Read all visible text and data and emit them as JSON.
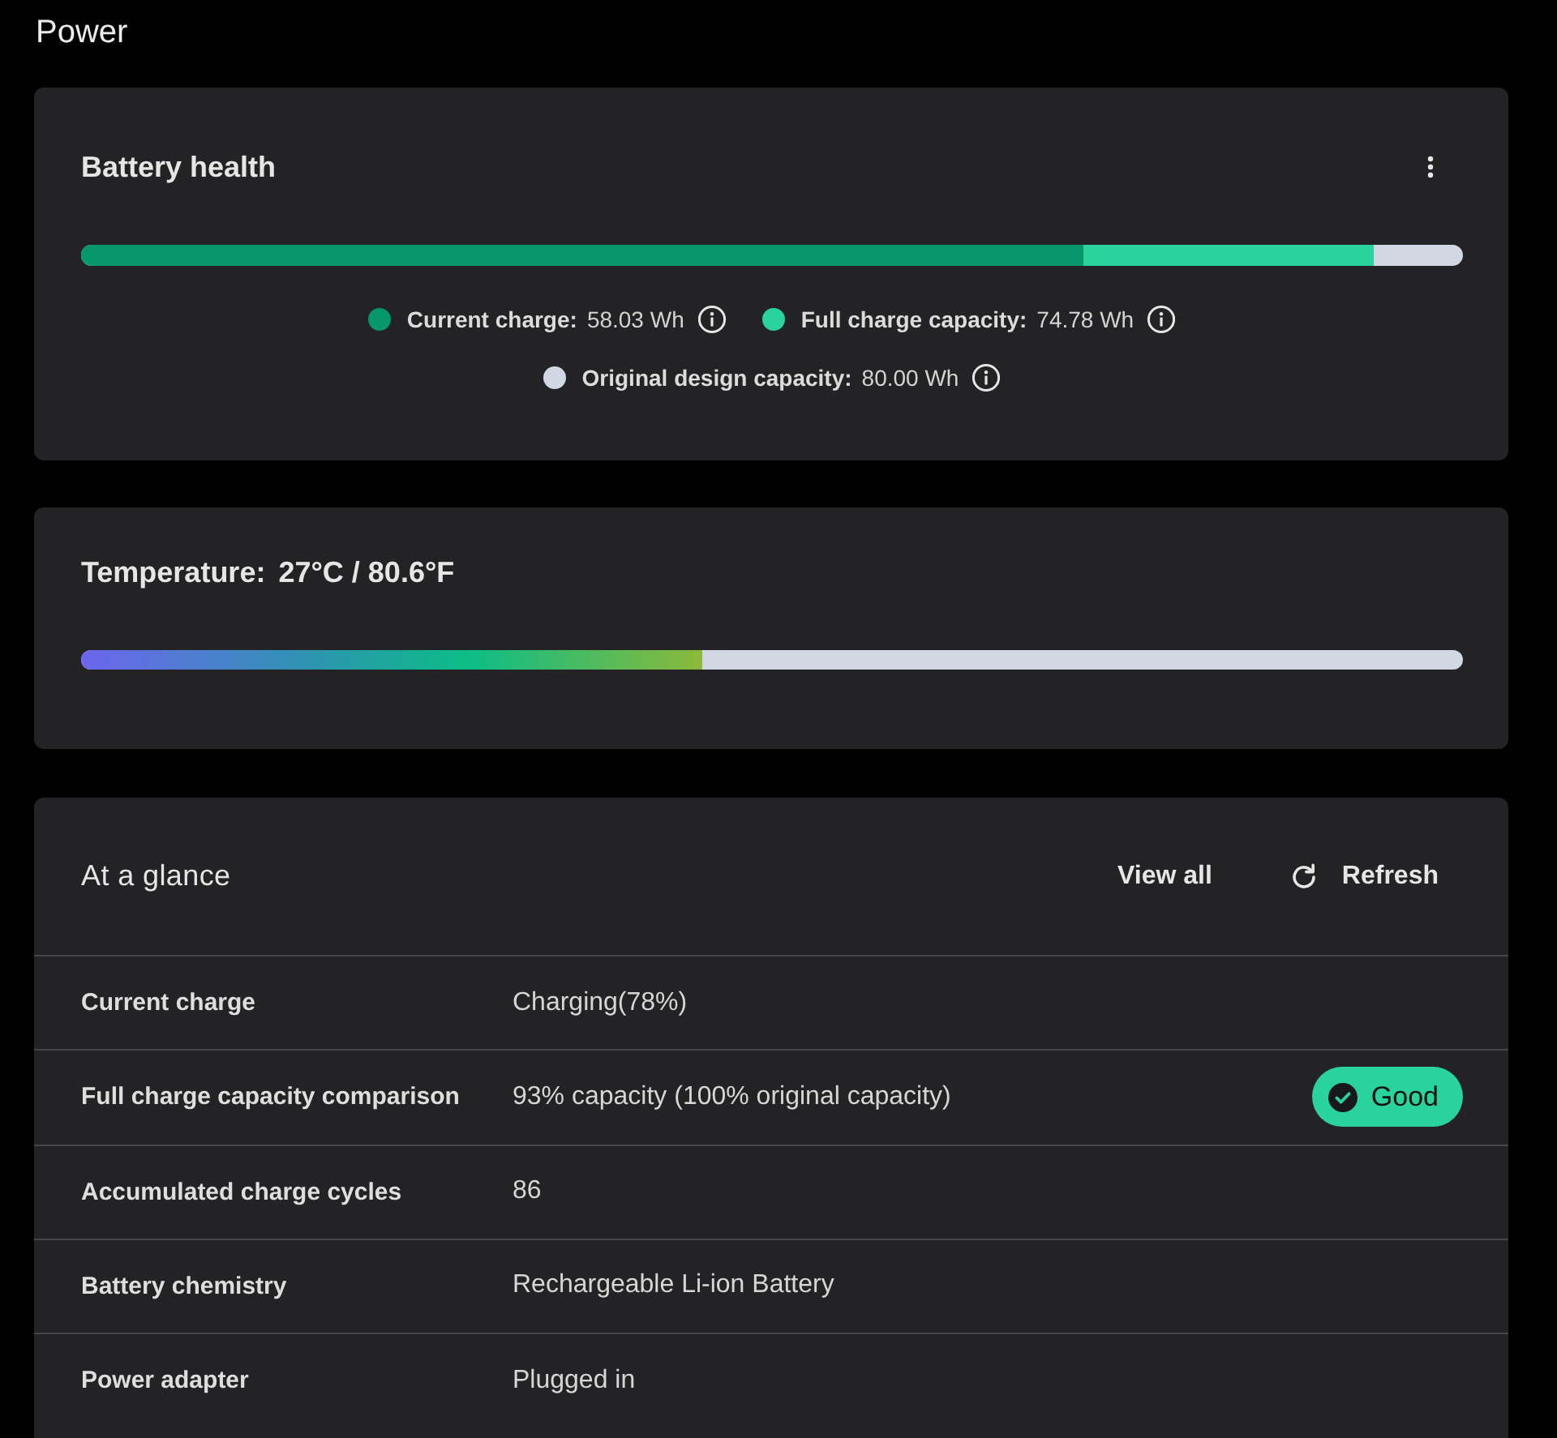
{
  "page_title": "Power",
  "battery_health": {
    "title": "Battery health",
    "legend": [
      {
        "label": "Current charge:",
        "value": "58.03 Wh",
        "color": "#05966b",
        "level": 0.725
      },
      {
        "label": "Full charge capacity:",
        "value": "74.78 Wh",
        "color": "#2bd39c",
        "level": 0.935
      },
      {
        "label": "Original design capacity:",
        "value": "80.00 Wh",
        "color": "#d2d7e4",
        "level": 1
      }
    ]
  },
  "temperature": {
    "label": "Temperature:",
    "value": "27°C / 80.6°F",
    "level": 0.45
  },
  "at_a_glance": {
    "title": "At a glance",
    "actions": [
      {
        "label": "View all",
        "kind": "link"
      },
      {
        "label": "Refresh",
        "kind": "refresh"
      }
    ],
    "rows": [
      {
        "label": "Current charge",
        "value": "Charging(78%)"
      },
      {
        "label": "Full charge capacity comparison",
        "value": "93% capacity (100% original capacity)",
        "badge": {
          "label": "Good"
        }
      },
      {
        "label": "Accumulated charge cycles",
        "value": "86"
      },
      {
        "label": "Battery chemistry",
        "value": "Rechargeable Li-ion Battery"
      },
      {
        "label": "Power adapter",
        "value": "Plugged in"
      }
    ]
  }
}
